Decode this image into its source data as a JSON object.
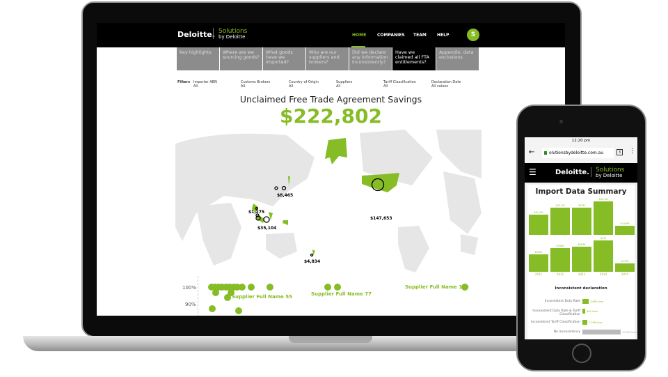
{
  "laptop": {
    "brand": "Deloitte.",
    "solutions": "Solutions",
    "solutions_by": "by Deloitte",
    "nav": [
      "HOME",
      "COMPANIES",
      "TEAM",
      "HELP"
    ],
    "avatar": "S",
    "tabs": [
      "Key highlights",
      "Where are we sourcing goods?",
      "What goods have we imported?",
      "Who are our suppliers and brokers?",
      "Did we declare any information inconsistently?",
      "Have we claimed all FTA entitlements?",
      "Appendix: data exclusions"
    ],
    "active_tab": "Have we claimed all FTA entitlements?",
    "filters_label": "Filters",
    "filters": [
      {
        "name": "Importer ABN",
        "value": "All"
      },
      {
        "name": "Customs Brokers",
        "value": "All"
      },
      {
        "name": "Country of Origin",
        "value": "All"
      },
      {
        "name": "Suppliers",
        "value": "All"
      },
      {
        "name": "Tariff Classification",
        "value": "All"
      },
      {
        "name": "Declaration Date",
        "value": "All values"
      }
    ],
    "title": "Unclaimed Free Trade Agreement Savings",
    "total": "$222,802",
    "map_labels": [
      "$8,465",
      "$147,653",
      "$1,275",
      "$35,104",
      "$4,834"
    ],
    "scatter": {
      "y_ticks": [
        "100%",
        "90%"
      ],
      "labels": [
        "Supplier Full Name 55",
        "Supplier Full Name 77",
        "Supplier Full Name 129"
      ]
    }
  },
  "phone": {
    "time": "12:20 pm",
    "url": "olutionsbydeloitte.com.au",
    "tab_count": "3",
    "brand": "Deloitte.",
    "solutions": "Solutions",
    "solutions_by": "by Deloitte",
    "title": "Import Data Summary",
    "chart_data": {
      "type": "bar",
      "categories": [
        "2011",
        "2012",
        "2013",
        "2014",
        "2015"
      ],
      "series": [
        {
          "labels": [
            "$31.2M",
            "$42.1M",
            "$42M",
            "$52.3M",
            "$14.6M"
          ],
          "values": [
            31.2,
            42.1,
            42,
            52.3,
            14.6
          ]
        },
        {
          "labels": [
            "$560K",
            "$764K",
            "$803K",
            "$1M",
            "$277K"
          ],
          "values": [
            560,
            764,
            803,
            1000,
            277
          ]
        }
      ]
    },
    "inconsistent": {
      "title": "Inconsistent declaration",
      "rows": [
        {
          "label": "Inconsistent Duty Rate",
          "value": "3,665 lines"
        },
        {
          "label": "Inconsistent Duty Rate & Tariff Classification",
          "value": "963 lines"
        },
        {
          "label": "Inconsistent Tariff Classification",
          "value": "1,398 lines"
        },
        {
          "label": "No Inconsistency",
          "value": "10,929 lines"
        }
      ]
    },
    "accent": "#86bc25"
  }
}
